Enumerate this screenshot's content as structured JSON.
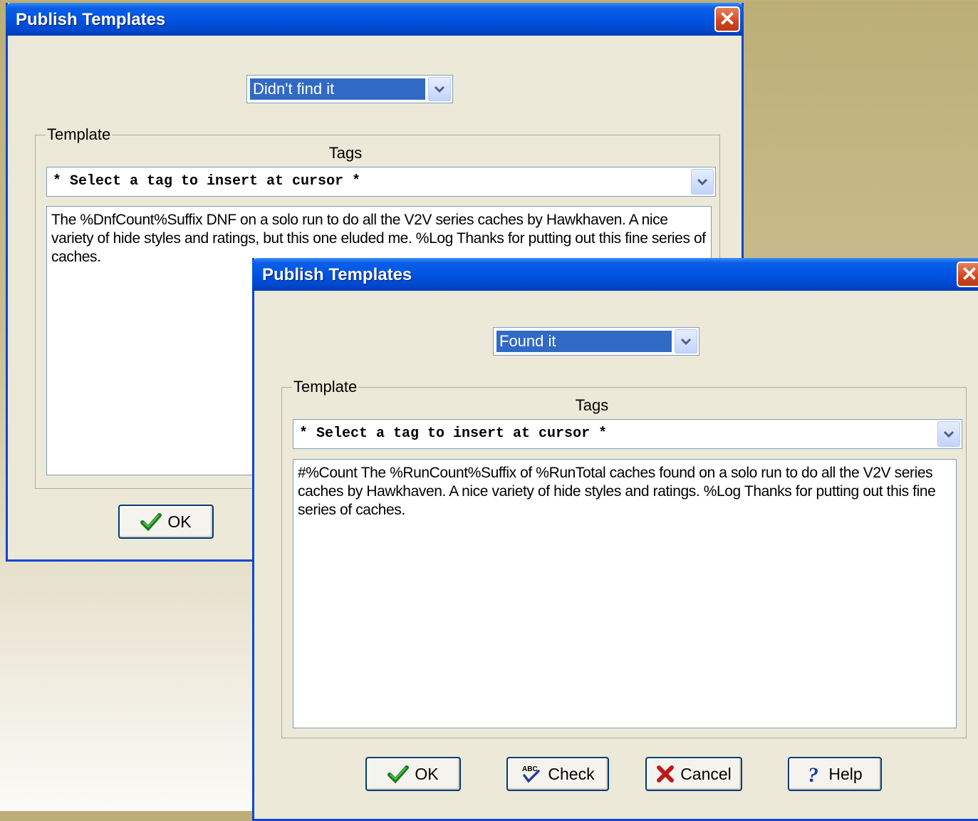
{
  "back_dialog": {
    "title": "Publish Templates",
    "close_glyph": "✕",
    "log_type": "Didn't find it",
    "group_label": "Template",
    "tags_label": "Tags",
    "tag_placeholder": "* Select a tag to insert at cursor *",
    "template_text": "The %DnfCount%Suffix DNF on a solo run to do all the V2V series caches by Hawkhaven. A nice variety of hide styles and ratings, but this one eluded me. %Log Thanks for putting out this fine series of caches.",
    "ok_label": "OK"
  },
  "front_dialog": {
    "title": "Publish Templates",
    "close_glyph": "✕",
    "log_type": "Found it",
    "group_label": "Template",
    "tags_label": "Tags",
    "tag_placeholder": "* Select a tag to insert at cursor *",
    "template_text": "#%Count The %RunCount%Suffix of %RunTotal caches found on a solo run to do all the V2V series caches by Hawkhaven. A nice variety of hide styles and ratings. %Log Thanks for putting out this fine series of caches.",
    "buttons": {
      "ok": "OK",
      "check": "Check",
      "cancel": "Cancel",
      "help": "Help"
    }
  },
  "icons": {
    "ok": "checkmark-icon",
    "check": "spellcheck-icon",
    "cancel": "x-mark-icon",
    "help": "question-mark-icon",
    "dropdown": "chevron-down-icon"
  },
  "colors": {
    "titlebar": "#0054e3",
    "selection": "#316ac5",
    "dialog_bg": "#ece9d8",
    "close_button": "#d0461f"
  }
}
